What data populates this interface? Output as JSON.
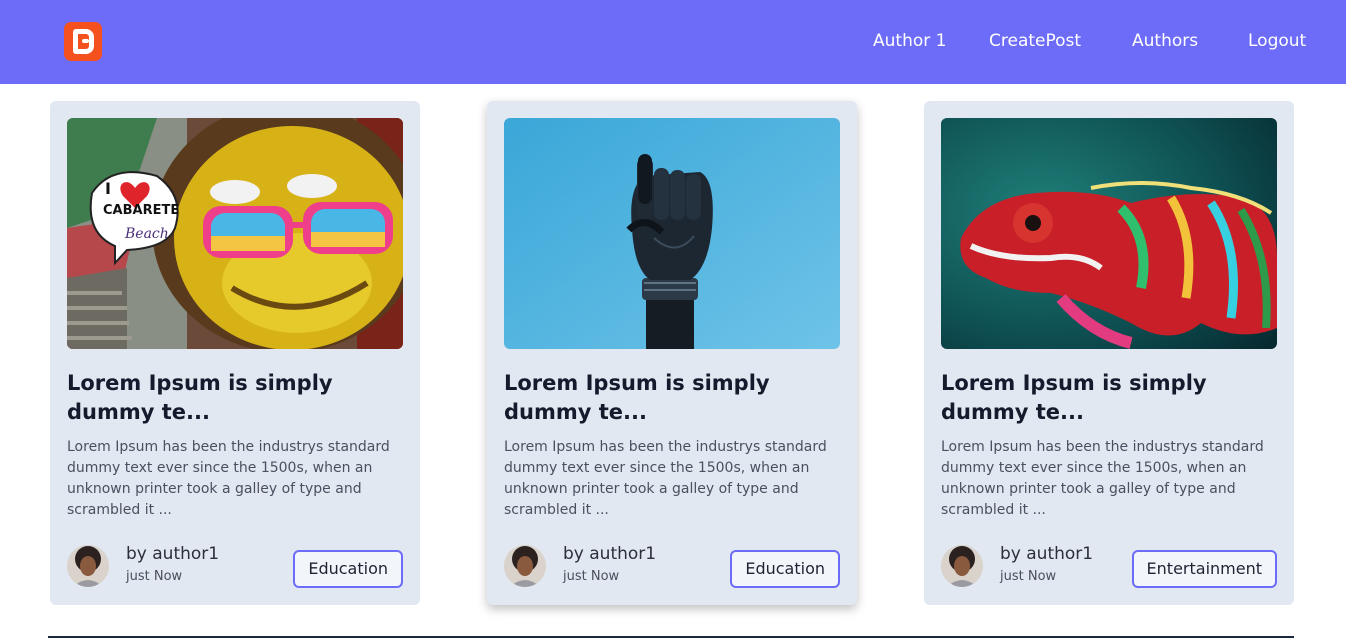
{
  "nav": {
    "logo": "blogger-logo",
    "links": [
      "Author 1",
      "CreatePost",
      "Authors",
      "Logout"
    ]
  },
  "posts": [
    {
      "image": "graffiti-monkey-with-sunglasses",
      "title": "Lorem Ipsum is simply dummy te...",
      "excerpt": "Lorem Ipsum has been the industrys standard dummy text ever since the 1500s, when an unknown printer took a galley of type and scrambled it ...",
      "author": "by author1",
      "time": "just Now",
      "category": "Education"
    },
    {
      "image": "robotic-hand-pointing-up",
      "title": "Lorem Ipsum is simply dummy te...",
      "excerpt": "Lorem Ipsum has been the industrys standard dummy text ever since the 1500s, when an unknown printer took a galley of type and scrambled it ...",
      "author": "by author1",
      "time": "just Now",
      "category": "Education"
    },
    {
      "image": "colorful-chameleon",
      "title": "Lorem Ipsum is simply dummy te...",
      "excerpt": "Lorem Ipsum has been the industrys standard dummy text ever since the 1500s, when an unknown printer took a galley of type and scrambled it ...",
      "author": "by author1",
      "time": "just Now",
      "category": "Entertainment"
    }
  ],
  "colors": {
    "navbar": "#6c6cf9",
    "card_bg": "#e1e8f1",
    "tag_border": "#6c6cf9",
    "logo": "#f4511e"
  }
}
